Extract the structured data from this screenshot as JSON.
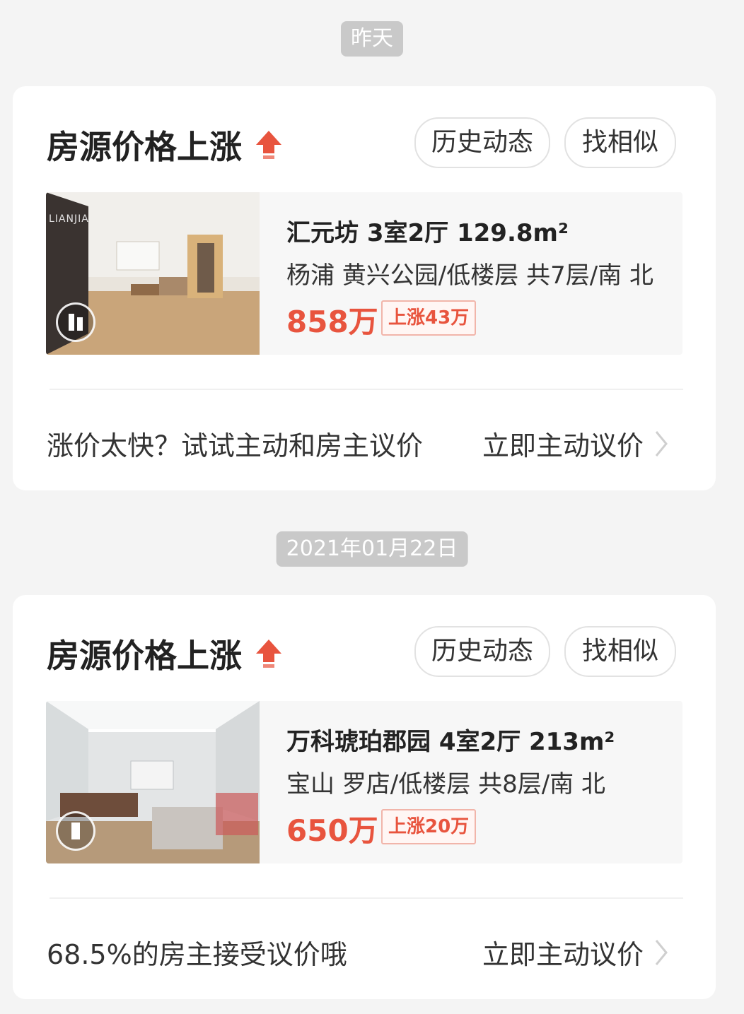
{
  "groups": [
    {
      "date_label": "昨天",
      "card": {
        "title": "房源价格上涨",
        "history_button": "历史动态",
        "similar_button": "找相似",
        "listing": {
          "watermark": "LIANJIA",
          "title": "汇元坊 3室2厅 129.8m²",
          "subtitle": "杨浦 黄兴公园/低楼层 共7层/南 北",
          "price": "858万",
          "change": "上涨43万"
        },
        "footer_text": "涨价太快？试试主动和房主议价",
        "footer_action": "立即主动议价"
      }
    },
    {
      "date_label": "2021年01月22日",
      "card": {
        "title": "房源价格上涨",
        "history_button": "历史动态",
        "similar_button": "找相似",
        "listing": {
          "title": "万科琥珀郡园 4室2厅 213m²",
          "subtitle": "宝山 罗店/低楼层 共8层/南 北",
          "price": "650万",
          "change": "上涨20万"
        },
        "footer_text": "68.5%的房主接受议价哦",
        "footer_action": "立即主动议价"
      }
    }
  ],
  "colors": {
    "accent": "#e8543e",
    "background": "#f4f4f4",
    "date_pill": "#c9c9c9"
  }
}
